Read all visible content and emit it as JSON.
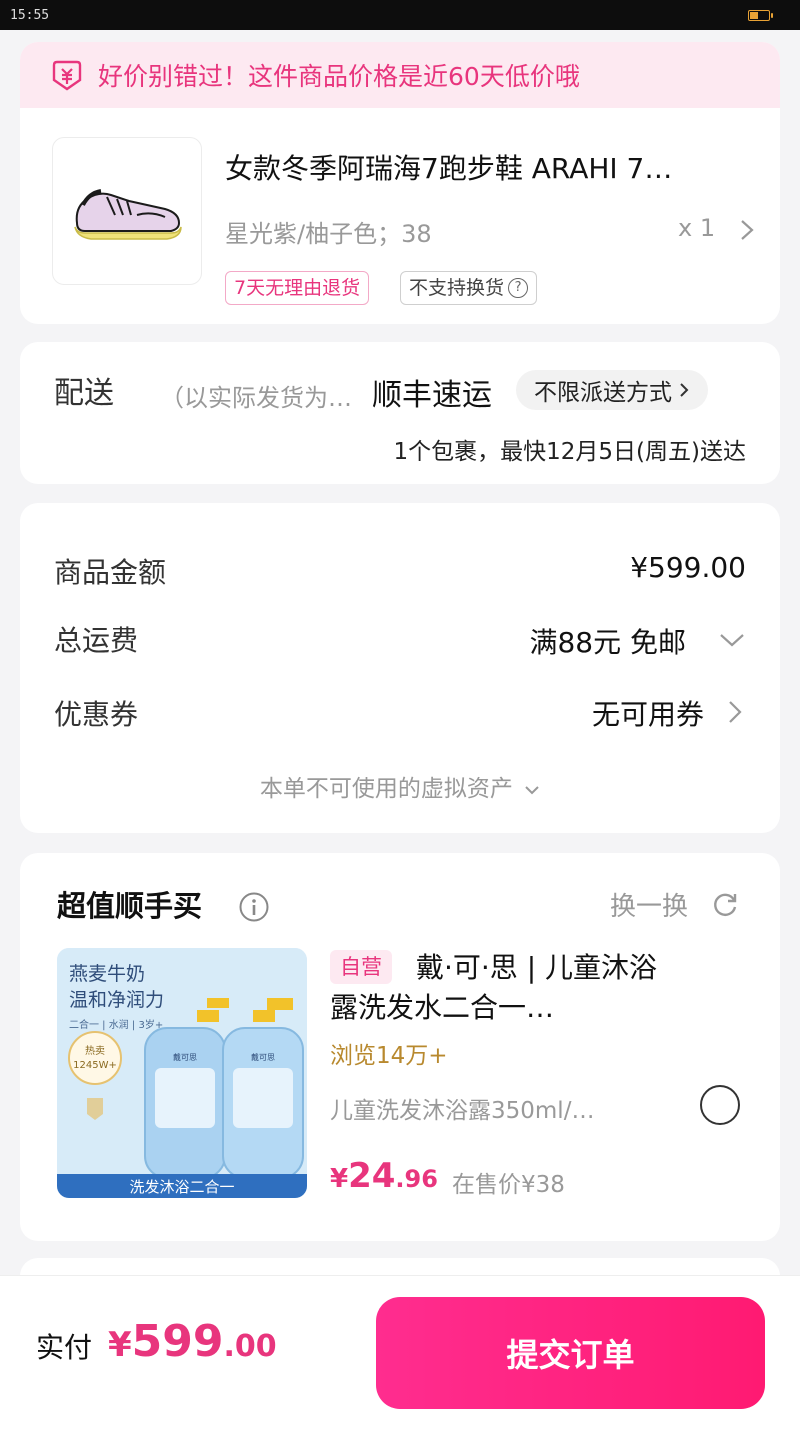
{
  "status_bar": {
    "time": "15:55"
  },
  "product": {
    "banner_text": "好价别错过！这件商品价格是近60天低价哦",
    "title": "女款冬季阿瑞海7跑步鞋 ARAHI 7…",
    "spec": "星光紫/柚子色；38",
    "quantity": "x 1",
    "tag_return": "7天无理由退货",
    "tag_exchange": "不支持换货",
    "tag_exchange_icon": "?",
    "colors": {
      "upper": "#e6d3ea",
      "sole": "#efe27a",
      "accent": "#1b1b1b"
    }
  },
  "delivery": {
    "label": "配送",
    "note": "（以实际发货为…",
    "carrier": "顺丰速运",
    "method": "不限派送方式",
    "eta": "1个包裹，最快12月5日(周五)送达"
  },
  "summary": {
    "goods_label": "商品金额",
    "goods_value": "¥599.00",
    "shipping_label": "总运费",
    "shipping_value": "满88元 免邮",
    "coupon_label": "优惠券",
    "coupon_value": "无可用券",
    "assets_note": "本单不可使用的虚拟资产"
  },
  "addon": {
    "title": "超值顺手买",
    "refresh": "换一换",
    "image_text": {
      "headline1": "燕麦牛奶",
      "headline2": "温和净润力",
      "subline": "二合一 | 水润 | 3岁+",
      "sales_label": "热卖",
      "sales_value": "1245W+",
      "brand": "戴可思",
      "bottom_banner": "洗发沐浴二合一"
    },
    "badge": "自营",
    "name": "戴·可·思 | 儿童沐浴露洗发水二合一…",
    "views": "浏览14万+",
    "spec": "儿童洗发沐浴露350ml/…",
    "price_symbol": "¥",
    "price_int": "24",
    "price_dec": ".96",
    "orig_price": "在售价¥38"
  },
  "footer": {
    "pay_label": "实付",
    "pay_symbol": "¥",
    "pay_int": "599",
    "pay_dec": ".00",
    "submit": "提交订单"
  },
  "theme": {
    "accent": "#e8357d",
    "button": "#ff1a72"
  }
}
